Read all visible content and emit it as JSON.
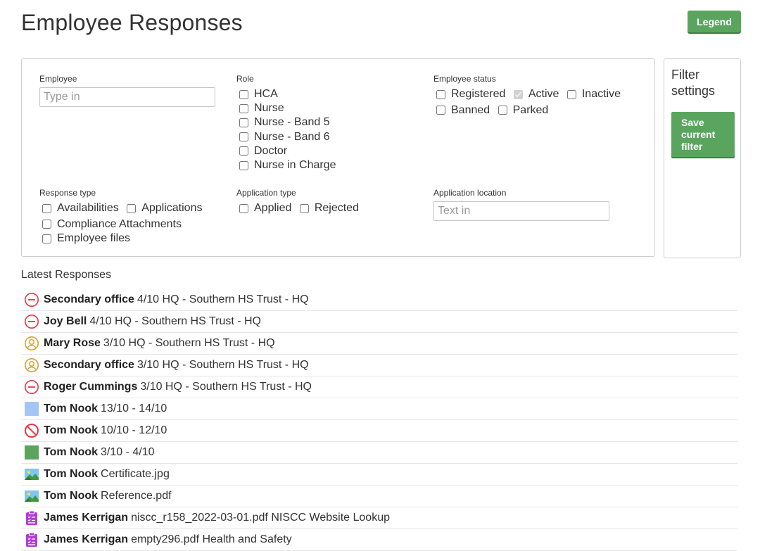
{
  "page": {
    "title": "Employee Responses",
    "legend_label": "Legend"
  },
  "filters": {
    "employee": {
      "label": "Employee",
      "placeholder": "Type in"
    },
    "role": {
      "label": "Role",
      "options": [
        {
          "label": "HCA",
          "checked": false
        },
        {
          "label": "Nurse",
          "checked": false
        },
        {
          "label": "Nurse - Band 5",
          "checked": false
        },
        {
          "label": "Nurse - Band 6",
          "checked": false
        },
        {
          "label": "Doctor",
          "checked": false
        },
        {
          "label": "Nurse in Charge",
          "checked": false
        }
      ]
    },
    "employee_status": {
      "label": "Employee status",
      "options": [
        {
          "label": "Registered",
          "checked": false,
          "disabled": false
        },
        {
          "label": "Active",
          "checked": true,
          "disabled": true
        },
        {
          "label": "Inactive",
          "checked": false,
          "disabled": false
        },
        {
          "label": "Banned",
          "checked": false,
          "disabled": false
        },
        {
          "label": "Parked",
          "checked": false,
          "disabled": false
        }
      ]
    },
    "response_type": {
      "label": "Response type",
      "options": [
        {
          "label": "Availabilities",
          "checked": false
        },
        {
          "label": "Applications",
          "checked": false
        },
        {
          "label": "Compliance Attachments",
          "checked": false
        },
        {
          "label": "Employee files",
          "checked": false
        }
      ]
    },
    "application_type": {
      "label": "Application type",
      "options": [
        {
          "label": "Applied",
          "checked": false
        },
        {
          "label": "Rejected",
          "checked": false
        }
      ]
    },
    "application_location": {
      "label": "Application location",
      "placeholder": "Text in"
    }
  },
  "filter_settings": {
    "title": "Filter settings",
    "save_label": "Save current filter"
  },
  "responses": {
    "title": "Latest Responses",
    "colors": {
      "rejected": "#e0394b",
      "pending": "#d1a43a",
      "available": "#a4c6f7",
      "blocked": "#e53945",
      "booked": "#5aa55e",
      "compliance": "#b23bd6"
    },
    "items": [
      {
        "icon": "minus-circle-icon",
        "name": "Secondary office",
        "detail": "4/10 HQ - Southern HS Trust - HQ"
      },
      {
        "icon": "minus-circle-icon",
        "name": "Joy Bell",
        "detail": "4/10 HQ - Southern HS Trust - HQ"
      },
      {
        "icon": "user-circle-icon",
        "name": "Mary Rose",
        "detail": "3/10 HQ - Southern HS Trust - HQ"
      },
      {
        "icon": "user-circle-icon",
        "name": "Secondary office",
        "detail": "3/10 HQ - Southern HS Trust - HQ"
      },
      {
        "icon": "minus-circle-icon",
        "name": "Roger Cummings",
        "detail": "3/10 HQ - Southern HS Trust - HQ"
      },
      {
        "icon": "blue-square-icon",
        "name": "Tom Nook",
        "detail": "13/10 - 14/10"
      },
      {
        "icon": "no-entry-icon",
        "name": "Tom Nook",
        "detail": "10/10 - 12/10"
      },
      {
        "icon": "green-square-icon",
        "name": "Tom Nook",
        "detail": "3/10 - 4/10"
      },
      {
        "icon": "image-icon",
        "name": "Tom Nook",
        "detail": "Certificate.jpg"
      },
      {
        "icon": "image-icon",
        "name": "Tom Nook",
        "detail": "Reference.pdf"
      },
      {
        "icon": "clipboard-icon",
        "name": "James Kerrigan",
        "detail": "niscc_r158_2022-03-01.pdf NISCC Website Lookup"
      },
      {
        "icon": "clipboard-icon",
        "name": "James Kerrigan",
        "detail": "empty296.pdf Health and Safety"
      }
    ]
  }
}
